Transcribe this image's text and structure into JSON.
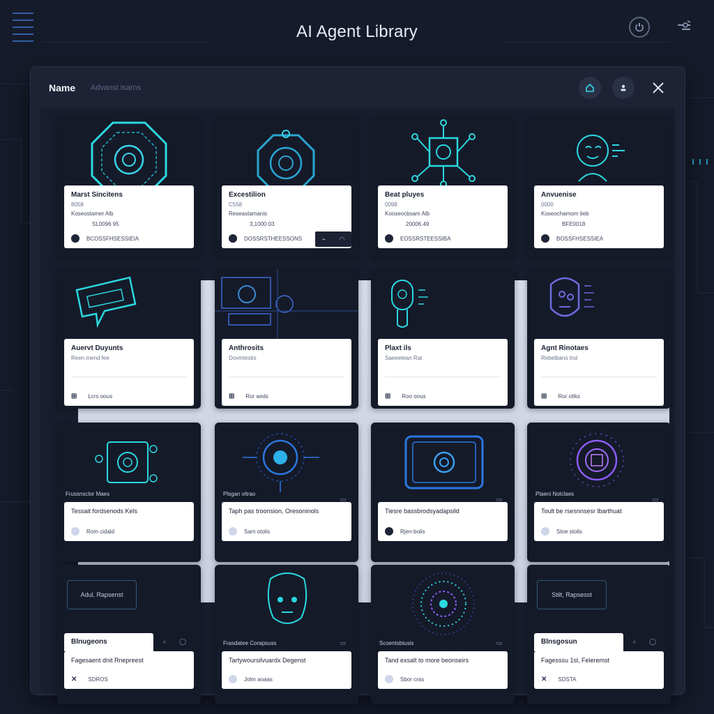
{
  "app": {
    "title": "AI Agent Library"
  },
  "header": {
    "name_label": "Name",
    "sub_label": "Advanst lsarns"
  },
  "colors": {
    "background": "#161b2b",
    "accent": "#38d4e8",
    "violet": "#8b5cf6",
    "card": "#151a29"
  },
  "icons": {
    "power": "power-icon",
    "settings": "settings-icon",
    "home": "home-icon",
    "user": "user-icon",
    "close": "close-icon"
  },
  "cards": {
    "r1": [
      {
        "title": "Marst Sincitens",
        "sub": "8058",
        "meta": "Koseostamer Alb",
        "val": "SL0096 95",
        "foot": "BCOSSFHSESSIEIA"
      },
      {
        "title": "Excestilion",
        "sub": "C558",
        "meta": "Reseastamanis",
        "val": "3,1000 03",
        "foot": "DOSSRSTHEESSONS"
      },
      {
        "title": "Beat pluyes",
        "sub": "0098",
        "meta": "Kooseocbsam Alb",
        "val": "20006.49",
        "foot": "EOSSRSTEESSIBA"
      },
      {
        "title": "Anvuenise",
        "sub": "0000",
        "meta": "Koseochamom tieb",
        "val": "BFE0018",
        "foot": "BOSSFHSESSIEA"
      }
    ],
    "r2": [
      {
        "title": "Auervt Duyunts",
        "sub": "Reen mend fee",
        "foot": "Lcrs oous"
      },
      {
        "title": "Anthrosits",
        "sub": "Dovmtestis",
        "foot": "Ror aeds"
      },
      {
        "title": "Plaxt ils",
        "sub": "Saeeetean Rat",
        "foot": "Roo oous"
      },
      {
        "title": "Agnt Rinotaes",
        "sub": "Rebelbano tnd",
        "foot": "Ror otiks"
      }
    ],
    "r3": [
      {
        "tag": "Frussnsclor Maes",
        "title": "Tessait fordsenods Kels",
        "foot": "Rom cidald"
      },
      {
        "tag": "Plsgan vitrao",
        "title": "Taph pas troonsion, Oresoninols",
        "foot": "Sam otolis"
      },
      {
        "tag": "",
        "title": "Tiesre bassbrodsyadapsild",
        "foot": "Rjen-bolis"
      },
      {
        "tag": "Plaeni Nolclaes",
        "title": "Toult be rsesnnsesr lbarthuat",
        "foot": "Stoe stolis"
      }
    ],
    "r4": [
      {
        "box": "Adul, Rapsenst",
        "chip": "Blnugeons",
        "title": "Fagesaent dnit Rnepreest",
        "foot": "SDROS"
      },
      {
        "tag": "Frasdatee Corapsuss",
        "title": "Tartywoursilvuardx Degenst",
        "foot": "Jolm aoaas"
      },
      {
        "tag": "Scoentsbiusis",
        "title": "Tand exsalt to more beonseirs",
        "foot": "Sbor cras"
      },
      {
        "box": "Stilt, Rapsesst",
        "chip": "Blnsgosun",
        "title": "Fagesssu 1sl, Feleremst",
        "foot": "SDSTA"
      }
    ]
  }
}
